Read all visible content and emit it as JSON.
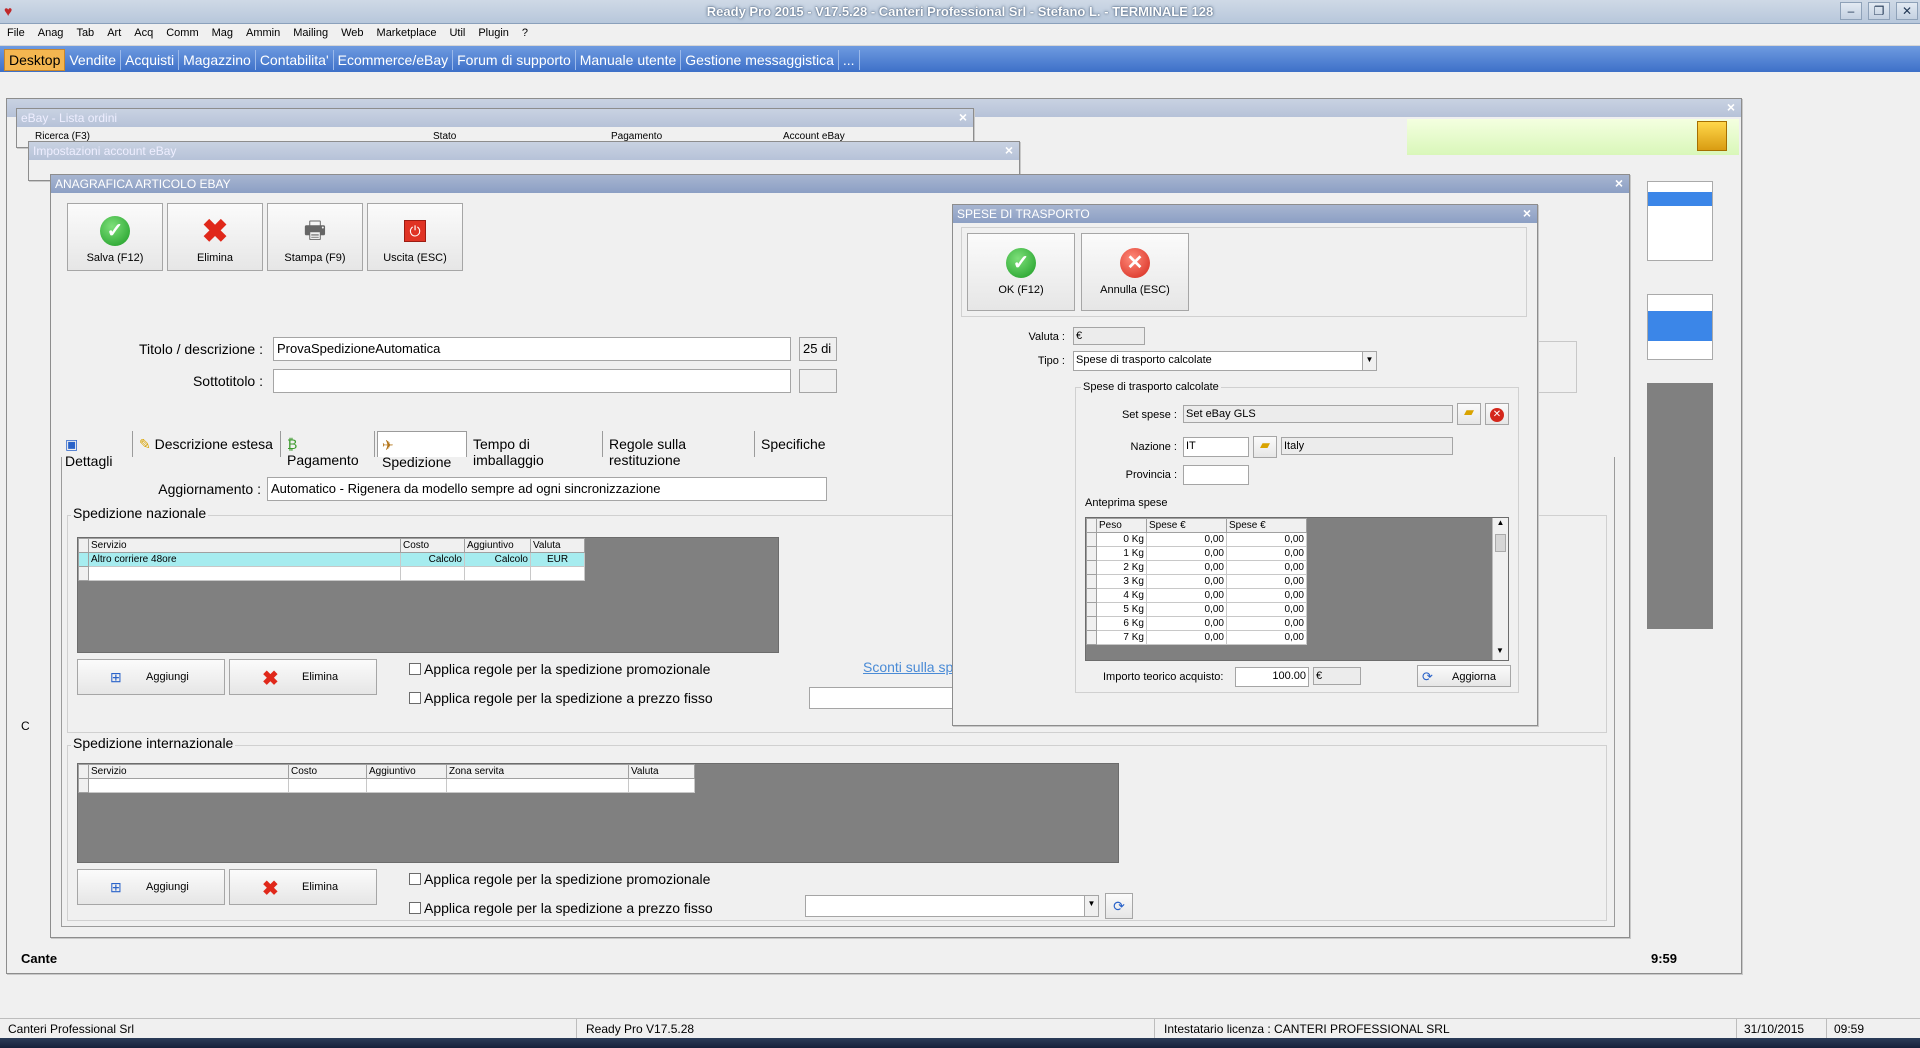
{
  "app": {
    "title": "Ready Pro 2015 - V17.5.28 - Canteri Professional Srl - Stefano L. - TERMINALE 128"
  },
  "menu": [
    "File",
    "Anag",
    "Tab",
    "Art",
    "Acq",
    "Comm",
    "Mag",
    "Ammin",
    "Mailing",
    "Web",
    "Marketplace",
    "Util",
    "Plugin",
    "?"
  ],
  "tabs": [
    "Desktop",
    "Vendite",
    "Acquisti",
    "Magazzino",
    "Contabilita'",
    "Ecommerce/eBay",
    "Forum di supporto",
    "Manuale utente",
    "Gestione messaggistica",
    "..."
  ],
  "bg_windows": {
    "lista_ordini": "eBay - Lista ordini",
    "lista_ordini_cols": [
      "Ricerca (F3)",
      "Stato",
      "Pagamento",
      "Account eBay"
    ],
    "impostazioni": "Impostazioni account eBay",
    "canteri_partial": "Cante",
    "c_partial": "C",
    "time_partial": "9:59"
  },
  "anagrafica": {
    "title": "ANAGRAFICA ARTICOLO EBAY",
    "toolbar": {
      "save": "Salva (F12)",
      "delete": "Elimina",
      "print": "Stampa (F9)",
      "exit": "Uscita (ESC)"
    },
    "title_label": "Titolo / descrizione :",
    "title_value": "ProvaSpedizioneAutomatica",
    "title_counter": "25 di",
    "subtitle_label": "Sottotitolo :",
    "subtitle_value": "",
    "tabs": [
      "Dettagli",
      "Descrizione estesa",
      "Pagamento",
      "Spedizione",
      "Tempo di imballaggio",
      "Regole sulla restituzione",
      "Specifiche"
    ],
    "aggiornamento_label": "Aggiornamento :",
    "aggiornamento_value": "Automatico - Rigenera da modello sempre ad ogni sincronizzazione",
    "nazionale": {
      "title": "Spedizione nazionale",
      "columns": [
        "Servizio",
        "Costo",
        "Aggiuntivo",
        "Valuta"
      ],
      "rows": [
        [
          "Altro corriere 48ore",
          "Calcolo",
          "Calcolo",
          "EUR"
        ]
      ],
      "add": "Aggiungi",
      "delete": "Elimina",
      "promo": "Applica regole per la spedizione promozionale",
      "fixed": "Applica regole per la spedizione a prezzo fisso",
      "link": "Sconti sulla spe"
    },
    "internazionale": {
      "title": "Spedizione internazionale",
      "columns": [
        "Servizio",
        "Costo",
        "Aggiuntivo",
        "Zona servita",
        "Valuta"
      ],
      "add": "Aggiungi",
      "delete": "Elimina",
      "promo": "Applica regole per la spedizione promozionale",
      "fixed": "Applica regole per la spedizione a prezzo fisso"
    }
  },
  "spese": {
    "title": "SPESE DI TRASPORTO",
    "ok": "OK (F12)",
    "cancel": "Annulla (ESC)",
    "valuta_label": "Valuta :",
    "valuta_value": "€",
    "tipo_label": "Tipo :",
    "tipo_value": "Spese di trasporto calcolate",
    "group_title": "Spese di trasporto calcolate",
    "set_label": "Set spese :",
    "set_value": "Set eBay GLS",
    "nazione_label": "Nazione :",
    "nazione_code": "IT",
    "nazione_name": "Italy",
    "provincia_label": "Provincia :",
    "provincia_value": "",
    "anteprima_label": "Anteprima spese",
    "preview_cols": [
      "Peso",
      "Spese €",
      "Spese €"
    ],
    "preview_rows": [
      [
        "0 Kg",
        "0,00",
        "0,00"
      ],
      [
        "1 Kg",
        "0,00",
        "0,00"
      ],
      [
        "2 Kg",
        "0,00",
        "0,00"
      ],
      [
        "3 Kg",
        "0,00",
        "0,00"
      ],
      [
        "4 Kg",
        "0,00",
        "0,00"
      ],
      [
        "5 Kg",
        "0,00",
        "0,00"
      ],
      [
        "6 Kg",
        "0,00",
        "0,00"
      ],
      [
        "7 Kg",
        "0,00",
        "0,00"
      ]
    ],
    "importo_label": "Importo teorico acquisto:",
    "importo_value": "100.00",
    "importo_currency": "€",
    "refresh": "Aggiorna"
  },
  "status": {
    "company": "Canteri Professional Srl",
    "version": "Ready Pro V17.5.28",
    "license": "Intestatario licenza : CANTERI PROFESSIONAL SRL",
    "date": "31/10/2015",
    "time": "09:59"
  }
}
